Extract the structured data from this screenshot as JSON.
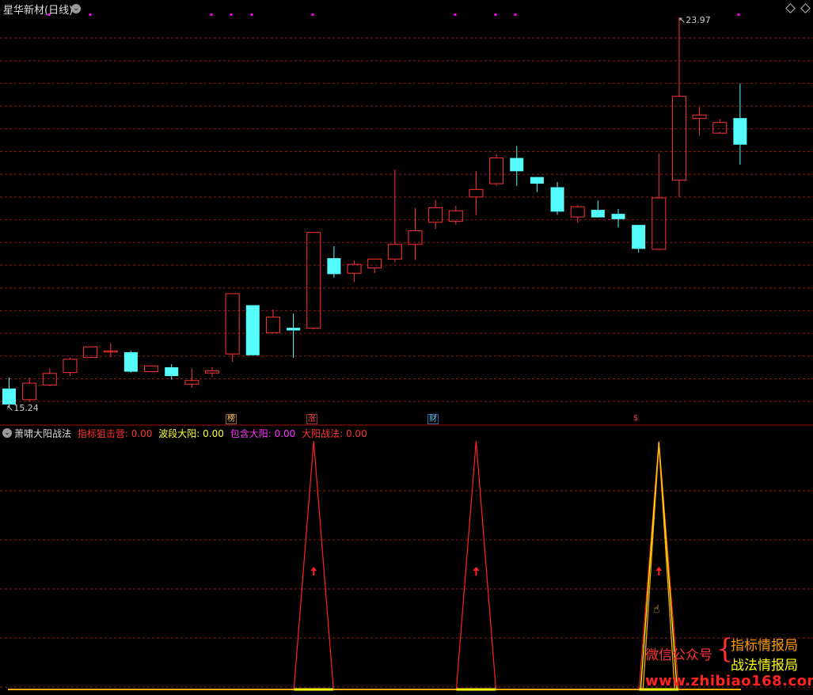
{
  "main_chart": {
    "title": "星华新材(日线)",
    "high_label": "23.97",
    "low_label": "15.24",
    "collapse_glyph": "⌄",
    "event_markers": [
      {
        "label": "榜",
        "color": "#ffcc66"
      },
      {
        "label": "涨",
        "color": "#ff4444"
      },
      {
        "label": "财",
        "color": "#66ccff"
      },
      {
        "label": "$",
        "color": "#ff4444"
      }
    ]
  },
  "indicator_panel": {
    "name": "萧啸大阳战法",
    "legend": [
      {
        "label": "指标狙击营:",
        "value": "0.00",
        "color": "#ff3333"
      },
      {
        "label": "波段大阳:",
        "value": "0.00",
        "color": "#ffff33"
      },
      {
        "label": "包含大阳:",
        "value": "0.00",
        "color": "#ff33ff"
      },
      {
        "label": "大阳战法:",
        "value": "0.00",
        "color": "#ff3333"
      }
    ]
  },
  "watermark": {
    "wechat_label": "微信公众号",
    "accounts": [
      "指标情报局",
      "战法情报局"
    ],
    "url": "www.zhibiao168.com"
  },
  "colors": {
    "up": "#ff3232",
    "down": "#54fcfc",
    "grid": "#8b1a1a",
    "magenta": "#ff00ff",
    "yellow": "#ffff00",
    "orange": "#ffaa00"
  },
  "chart_data": [
    {
      "type": "candlestick",
      "title": "星华新材(日线)",
      "ylim": [
        15.24,
        23.97
      ],
      "candles": [
        {
          "o": 15.6,
          "h": 15.85,
          "l": 15.2,
          "c": 15.24
        },
        {
          "o": 15.35,
          "h": 15.85,
          "l": 15.3,
          "c": 15.72
        },
        {
          "o": 15.68,
          "h": 16.05,
          "l": 15.65,
          "c": 15.94
        },
        {
          "o": 15.96,
          "h": 16.3,
          "l": 15.88,
          "c": 16.26
        },
        {
          "o": 16.3,
          "h": 16.55,
          "l": 16.3,
          "c": 16.54
        },
        {
          "o": 16.45,
          "h": 16.62,
          "l": 16.3,
          "c": 16.45
        },
        {
          "o": 16.42,
          "h": 16.45,
          "l": 15.96,
          "c": 15.98
        },
        {
          "o": 15.98,
          "h": 16.12,
          "l": 15.98,
          "c": 16.11
        },
        {
          "o": 16.08,
          "h": 16.15,
          "l": 15.8,
          "c": 15.88
        },
        {
          "o": 15.7,
          "h": 16.05,
          "l": 15.62,
          "c": 15.78
        },
        {
          "o": 15.95,
          "h": 16.08,
          "l": 15.86,
          "c": 16.0
        },
        {
          "o": 16.38,
          "h": 17.74,
          "l": 16.2,
          "c": 17.74
        },
        {
          "o": 17.48,
          "h": 17.48,
          "l": 16.35,
          "c": 16.35
        },
        {
          "o": 16.86,
          "h": 17.38,
          "l": 16.85,
          "c": 17.21
        },
        {
          "o": 16.97,
          "h": 17.29,
          "l": 16.29,
          "c": 16.91
        },
        {
          "o": 16.96,
          "h": 19.12,
          "l": 16.93,
          "c": 19.12
        },
        {
          "o": 18.54,
          "h": 18.81,
          "l": 18.1,
          "c": 18.18
        },
        {
          "o": 18.2,
          "h": 18.49,
          "l": 18.0,
          "c": 18.4
        },
        {
          "o": 18.32,
          "h": 18.52,
          "l": 18.2,
          "c": 18.52
        },
        {
          "o": 18.52,
          "h": 20.54,
          "l": 18.45,
          "c": 18.85
        },
        {
          "o": 18.85,
          "h": 19.67,
          "l": 18.5,
          "c": 19.16
        },
        {
          "o": 19.35,
          "h": 19.85,
          "l": 19.2,
          "c": 19.68
        },
        {
          "o": 19.37,
          "h": 19.72,
          "l": 19.3,
          "c": 19.61
        },
        {
          "o": 19.92,
          "h": 20.5,
          "l": 19.52,
          "c": 20.09
        },
        {
          "o": 20.22,
          "h": 20.89,
          "l": 20.17,
          "c": 20.8
        },
        {
          "o": 20.8,
          "h": 21.07,
          "l": 20.17,
          "c": 20.5
        },
        {
          "o": 20.37,
          "h": 20.29,
          "l": 20.03,
          "c": 20.22
        },
        {
          "o": 20.14,
          "h": 20.26,
          "l": 19.52,
          "c": 19.59
        },
        {
          "o": 19.47,
          "h": 19.73,
          "l": 19.34,
          "c": 19.7
        },
        {
          "o": 19.63,
          "h": 19.84,
          "l": 19.48,
          "c": 19.46
        },
        {
          "o": 19.54,
          "h": 19.65,
          "l": 19.23,
          "c": 19.42
        },
        {
          "o": 19.29,
          "h": 19.29,
          "l": 18.67,
          "c": 18.75
        },
        {
          "o": 18.74,
          "h": 20.9,
          "l": 18.72,
          "c": 19.9
        },
        {
          "o": 20.3,
          "h": 23.97,
          "l": 19.92,
          "c": 22.19
        },
        {
          "o": 21.69,
          "h": 21.95,
          "l": 21.3,
          "c": 21.77
        },
        {
          "o": 21.36,
          "h": 21.68,
          "l": 21.39,
          "c": 21.6
        },
        {
          "o": 21.7,
          "h": 22.48,
          "l": 20.65,
          "c": 21.1
        }
      ]
    },
    {
      "type": "line",
      "title": "萧啸大阳战法",
      "series": [
        {
          "name": "指标狙击营",
          "spikes_at_index": [
            15,
            23,
            32
          ]
        },
        {
          "name": "大阳战法",
          "spikes_at_index": [
            32
          ]
        }
      ]
    }
  ]
}
